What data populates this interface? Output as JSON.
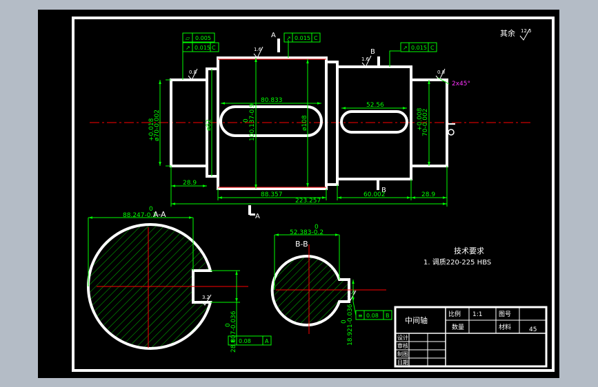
{
  "colors": {
    "background_outer": "#b4bcc6",
    "sheet": "#000000",
    "outline": "#ffffff",
    "dimension": "#00ff00",
    "centerline": "#ff0000",
    "hatch": "#00c000",
    "magenta": "#ff33ff"
  },
  "roughness": {
    "other": "其余",
    "other_value": "12.5",
    "surface1": "0.8",
    "surface2": "1.6",
    "surface3": "1.6",
    "surface4": "0.8",
    "section_a": "3.2",
    "section_b": "1.6"
  },
  "tolerance_frames": {
    "f1_value": "0.005",
    "f2_value": "0.015",
    "f2_datum": "C",
    "f3_value": "0.015",
    "f3_datum": "C",
    "f4_value": "0.015",
    "f4_datum": "C",
    "section_a_value": "0.08",
    "section_a_datum": "A",
    "section_b_value": "0.08",
    "section_b_datum": "B"
  },
  "section_markers": {
    "a_top": "A",
    "a_bottom": "A",
    "b_top": "B",
    "b_bottom": "B",
    "section_a_title": "A-A",
    "section_b_title": "B-B"
  },
  "dimensions": {
    "left_diameter_upper": "+0.018",
    "left_diameter_lower": "ø70-0.002",
    "shoulder_diameter": "ø82",
    "keyway_width_upper": "0",
    "keyway_width_lower": "100.137-0.9",
    "main_diameter": "ø108",
    "keyway_length_left": "80.833",
    "keyway_length_right": "52.56",
    "right_diameter_upper": "+0.008",
    "right_diameter_lower": "70-0.002",
    "chamfer": "2x45°",
    "left_step_length": "28.9",
    "main_length": "88.357",
    "overall_length": "223.257",
    "right_step_length": "60.002",
    "right_end_length": "28.9",
    "section_a_top_upper": "0",
    "section_a_top_lower": "88.247-0.2",
    "section_a_side_upper": "0",
    "section_a_side_lower": "28.807-0.036",
    "section_b_top_upper": "0",
    "section_b_top_lower": "52.383-0.2",
    "section_b_side_upper": "0",
    "section_b_side_lower": "18.921-0.036"
  },
  "tech_requirements": {
    "heading": "技术要求",
    "item1": "1. 调质220-225 HBS"
  },
  "title_block": {
    "part_name": "中间轴",
    "scale_label": "比例",
    "scale_value": "1:1",
    "drawing_no_label": "图号",
    "quantity_label": "数量",
    "material_label": "材料",
    "material_value": "45",
    "designer_label": "设计",
    "reviewer_label": "审核",
    "drafter_label": "制图",
    "date_label": "日期"
  }
}
